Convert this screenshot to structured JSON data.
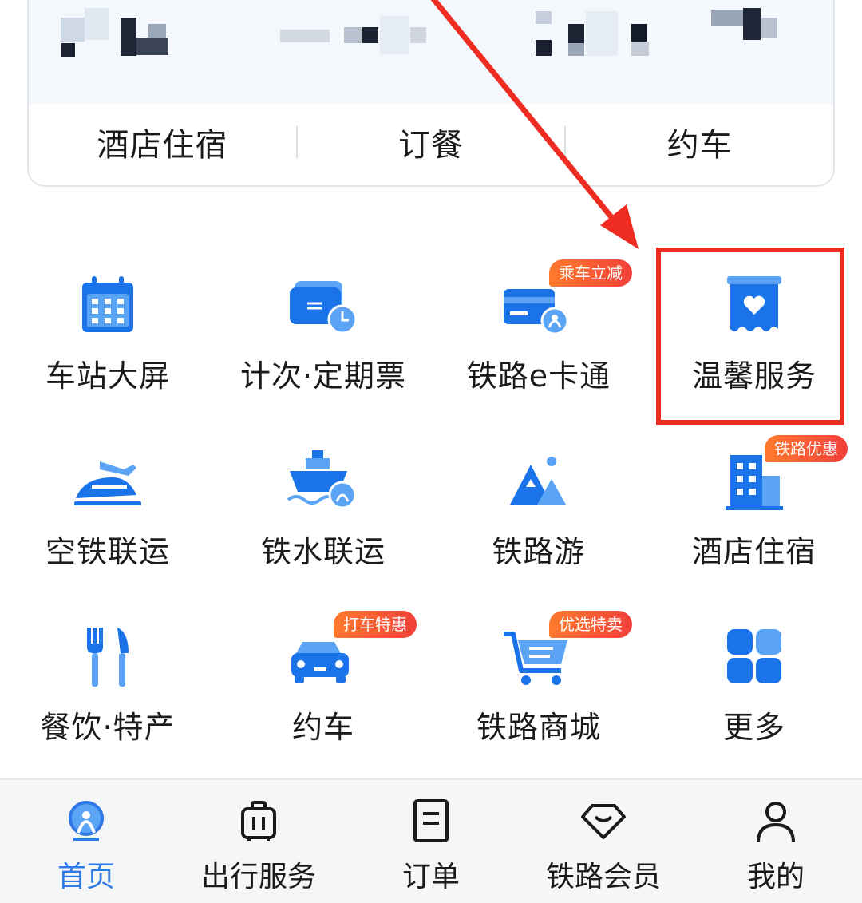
{
  "top_card": {
    "quick_links": [
      "酒店住宿",
      "订餐",
      "约车"
    ]
  },
  "services": [
    {
      "label": "车站大屏",
      "icon": "calendar-icon",
      "badge": ""
    },
    {
      "label": "计次·定期票",
      "icon": "ticket-clock-icon",
      "badge": ""
    },
    {
      "label": "铁路e卡通",
      "icon": "rail-card-icon",
      "badge": "乘车立减"
    },
    {
      "label": "温馨服务",
      "icon": "heart-service-icon",
      "badge": ""
    },
    {
      "label": "空铁联运",
      "icon": "plane-train-icon",
      "badge": ""
    },
    {
      "label": "铁水联运",
      "icon": "ship-rail-icon",
      "badge": ""
    },
    {
      "label": "铁路游",
      "icon": "mountain-icon",
      "badge": ""
    },
    {
      "label": "酒店住宿",
      "icon": "hotel-icon",
      "badge": "铁路优惠"
    },
    {
      "label": "餐饮·特产",
      "icon": "fork-knife-icon",
      "badge": ""
    },
    {
      "label": "约车",
      "icon": "car-icon",
      "badge": "打车特惠"
    },
    {
      "label": "铁路商城",
      "icon": "shopping-cart-icon",
      "badge": "优选特卖"
    },
    {
      "label": "更多",
      "icon": "grid-more-icon",
      "badge": ""
    }
  ],
  "tabbar": [
    {
      "label": "首页",
      "icon": "rail-logo-icon",
      "active": true
    },
    {
      "label": "出行服务",
      "icon": "luggage-icon",
      "active": false
    },
    {
      "label": "订单",
      "icon": "order-icon",
      "active": false
    },
    {
      "label": "铁路会员",
      "icon": "diamond-icon",
      "active": false
    },
    {
      "label": "我的",
      "icon": "person-icon",
      "active": false
    }
  ],
  "colors": {
    "accent_blue": "#1a73e8",
    "light_blue": "#5aa3f5",
    "badge_orange": "#f2403a",
    "highlight_red": "#ee2c22",
    "active_tab": "#2f7ae5"
  }
}
